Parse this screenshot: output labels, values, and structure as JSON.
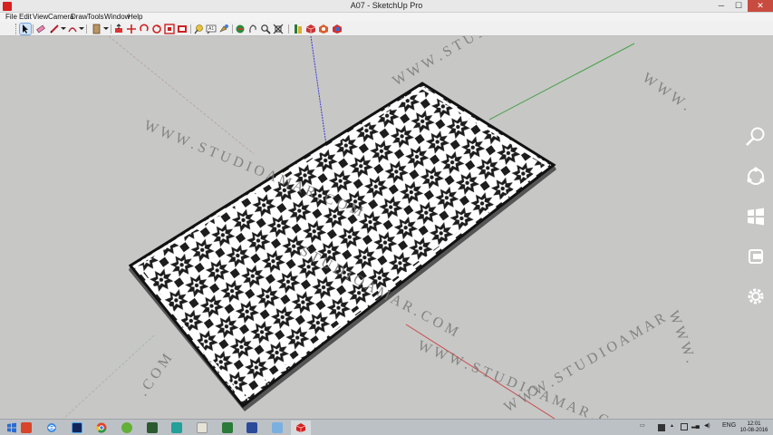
{
  "window": {
    "title": "A07 - SketchUp Pro",
    "minimize": "─",
    "maximize": "☐",
    "close": "✕"
  },
  "menu": [
    "File",
    "Edit",
    "View",
    "Camera",
    "Draw",
    "Tools",
    "Window",
    "Help"
  ],
  "toolbar": {
    "tools": [
      {
        "icon": "select-arrow-icon",
        "selected": true
      },
      {
        "icon": "eraser-icon"
      },
      {
        "icon": "pencil-line-icon"
      },
      {
        "icon": "arc-icon"
      },
      {
        "icon": "rectangle-icon"
      },
      {
        "icon": "push-pull-icon"
      },
      {
        "icon": "move-icon"
      },
      {
        "icon": "rotate-icon"
      },
      {
        "icon": "scale-icon"
      },
      {
        "icon": "offset-icon"
      },
      {
        "icon": "tape-measure-icon"
      },
      {
        "icon": "text-icon"
      },
      {
        "icon": "paint-bucket-icon"
      },
      {
        "icon": "orbit-icon"
      },
      {
        "icon": "pan-icon"
      },
      {
        "icon": "zoom-icon"
      },
      {
        "icon": "zoom-extents-icon"
      },
      {
        "icon": "warehouse-icon"
      },
      {
        "icon": "extension-warehouse-icon"
      },
      {
        "icon": "layout-icon"
      },
      {
        "icon": "extension-manager-icon"
      }
    ]
  },
  "watermark": {
    "text": "WWW.STUDIOAMAR.COM",
    "fragments": [
      "W W W . S T U D I O A M A R . C O M",
      "W W W . S T U D I O A M A R",
      "S T U D I O A M A R . C O M",
      "W W W .",
      ". C O M",
      "W W W . S T U D I O A M A R . C O M"
    ]
  },
  "colors": {
    "viewport": "#c7c7c6",
    "axis_green": "#4aa24a",
    "axis_blue": "#3a3ad8",
    "axis_red": "#c84a4a",
    "panel": "#ffffff",
    "pattern": "#1a1a1a"
  },
  "charms": [
    "search-charm-icon",
    "share-charm-icon",
    "start-charm-icon",
    "devices-charm-icon",
    "settings-charm-icon"
  ],
  "taskbar": {
    "apps": [
      {
        "icon": "start-icon"
      },
      {
        "icon": "file-manager-icon"
      },
      {
        "icon": "internet-explorer-icon"
      },
      {
        "icon": "photoshop-icon"
      },
      {
        "icon": "chrome-icon"
      },
      {
        "icon": "utorrent-icon"
      },
      {
        "icon": "sketchup-pro-icon"
      },
      {
        "icon": "media-icon"
      },
      {
        "icon": "excel-icon"
      },
      {
        "icon": "folder-icon"
      },
      {
        "icon": "remote-desktop-icon"
      },
      {
        "icon": "sketchup-icon",
        "active": true
      }
    ],
    "tray_lang": "ENG",
    "time": "12:01",
    "date": "10-08-2016"
  }
}
